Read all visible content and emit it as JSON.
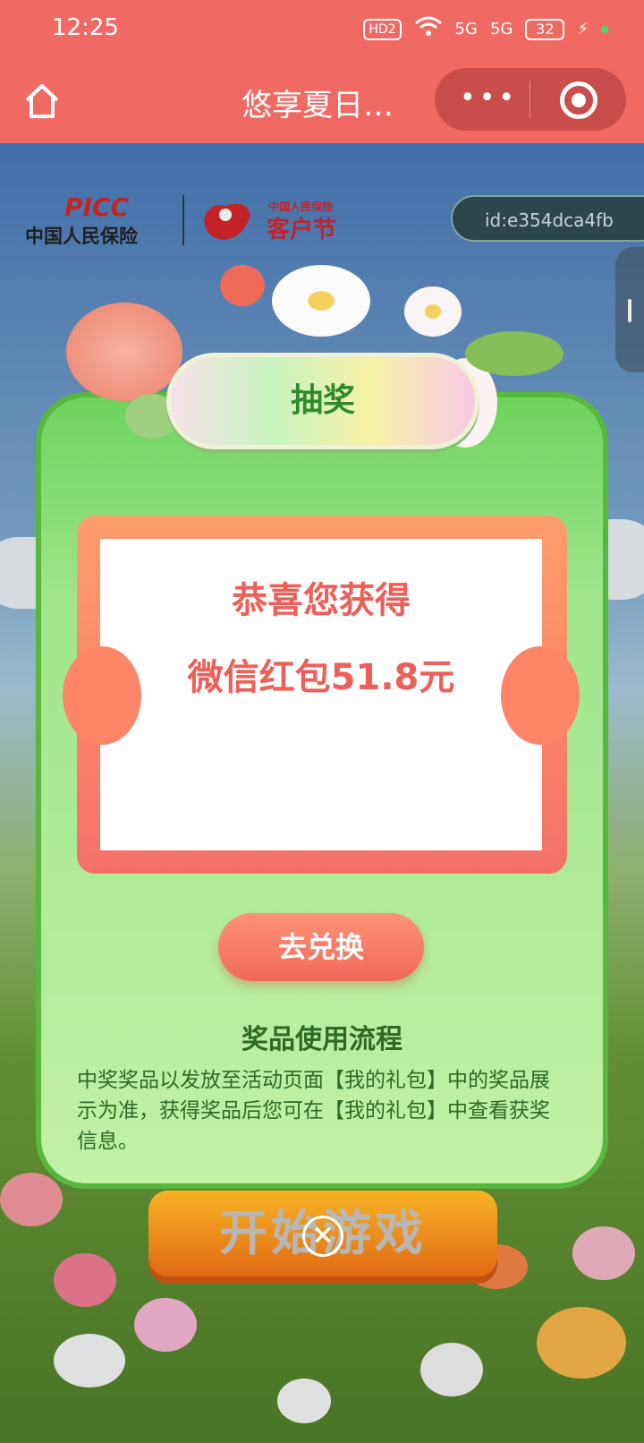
{
  "status_bar": {
    "time": "12:25",
    "hd": "HD2",
    "net1": "5G",
    "net2": "5G",
    "battery": "32"
  },
  "title_bar": {
    "title": "悠享夏日…",
    "more": "•••"
  },
  "header": {
    "picc_logo": "PICC",
    "picc_name": "中国人民保险",
    "festival_small": "中国人民保险",
    "festival": "客户节",
    "user_id": "id:e354dca4fb"
  },
  "modal": {
    "title": "抽奖",
    "congrats": "恭喜您获得",
    "prize": "微信红包51.8元",
    "redeem_label": "去兑换",
    "flow_title": "奖品使用流程",
    "flow_text": "中奖奖品以发放至活动页面【我的礼包】中的奖品展示为准，获得奖品后您可在【我的礼包】中查看获奖信息。"
  },
  "background": {
    "start_game": "开始游戏"
  },
  "colors": {
    "title_bar": "#f06a63",
    "modal_green": "#6ed35c",
    "prize_red": "#ed5f58",
    "text_green": "#2d6a24"
  }
}
